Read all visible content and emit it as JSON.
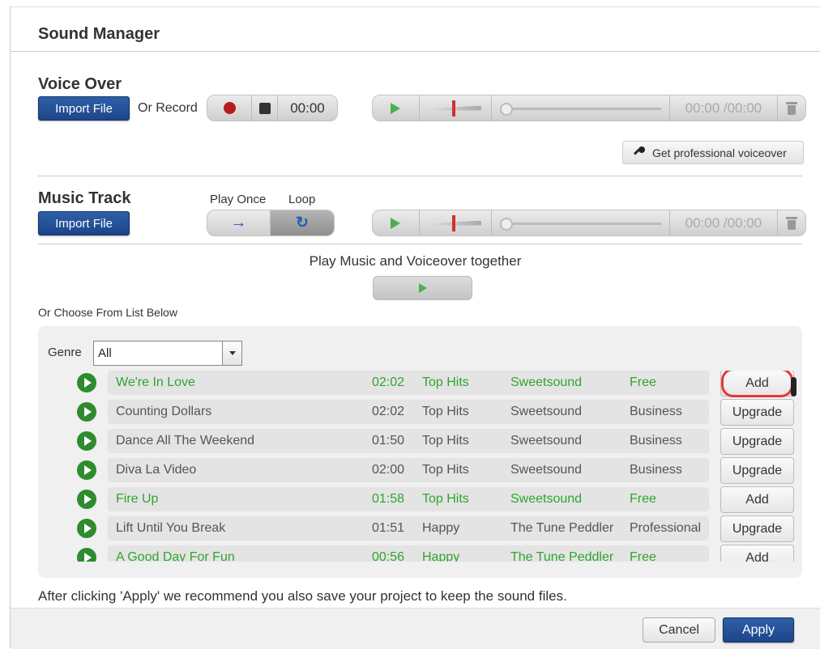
{
  "dialog": {
    "title": "Sound Manager"
  },
  "voice_over": {
    "heading": "Voice Over",
    "import_label": "Import File",
    "or_record": "Or Record",
    "record_time": "00:00",
    "player_time": "00:00 /00:00",
    "pro_voiceover_label": "Get professional voiceover"
  },
  "music_track": {
    "heading": "Music Track",
    "import_label": "Import File",
    "play_once": "Play Once",
    "loop": "Loop",
    "player_time": "00:00 /00:00"
  },
  "together": {
    "label": "Play Music and Voiceover together"
  },
  "list": {
    "heading": "Or Choose From List Below",
    "genre_label": "Genre",
    "genre_value": "All",
    "tracks": [
      {
        "title": "We're In Love",
        "duration": "02:02",
        "genre": "Top Hits",
        "artist": "Sweetsound",
        "tier": "Free",
        "action": "Add"
      },
      {
        "title": "Counting Dollars",
        "duration": "02:02",
        "genre": "Top Hits",
        "artist": "Sweetsound",
        "tier": "Business",
        "action": "Upgrade"
      },
      {
        "title": "Dance All The Weekend",
        "duration": "01:50",
        "genre": "Top Hits",
        "artist": "Sweetsound",
        "tier": "Business",
        "action": "Upgrade"
      },
      {
        "title": "Diva La Video",
        "duration": "02:00",
        "genre": "Top Hits",
        "artist": "Sweetsound",
        "tier": "Business",
        "action": "Upgrade"
      },
      {
        "title": "Fire Up",
        "duration": "01:58",
        "genre": "Top Hits",
        "artist": "Sweetsound",
        "tier": "Free",
        "action": "Add"
      },
      {
        "title": "Lift Until You Break",
        "duration": "01:51",
        "genre": "Happy",
        "artist": "The Tune Peddler",
        "tier": "Professional",
        "action": "Upgrade"
      },
      {
        "title": "A Good Day For Fun",
        "duration": "00:56",
        "genre": "Happy",
        "artist": "The Tune Peddler",
        "tier": "Free",
        "action": "Add"
      }
    ]
  },
  "footer": {
    "note": "After clicking 'Apply' we recommend you also save your project to keep the sound files.",
    "cancel_label": "Cancel",
    "apply_label": "Apply"
  },
  "colors": {
    "primary": "#1e4589",
    "free_text": "#2ea52e",
    "highlight_circle": "#e53935",
    "play_green": "#4caf50"
  },
  "icons": [
    "record-icon",
    "stop-icon",
    "play-icon",
    "volume-slider-icon",
    "trash-icon",
    "microphone-icon",
    "arrow-right-icon",
    "loop-icon",
    "dropdown-arrow-icon"
  ]
}
